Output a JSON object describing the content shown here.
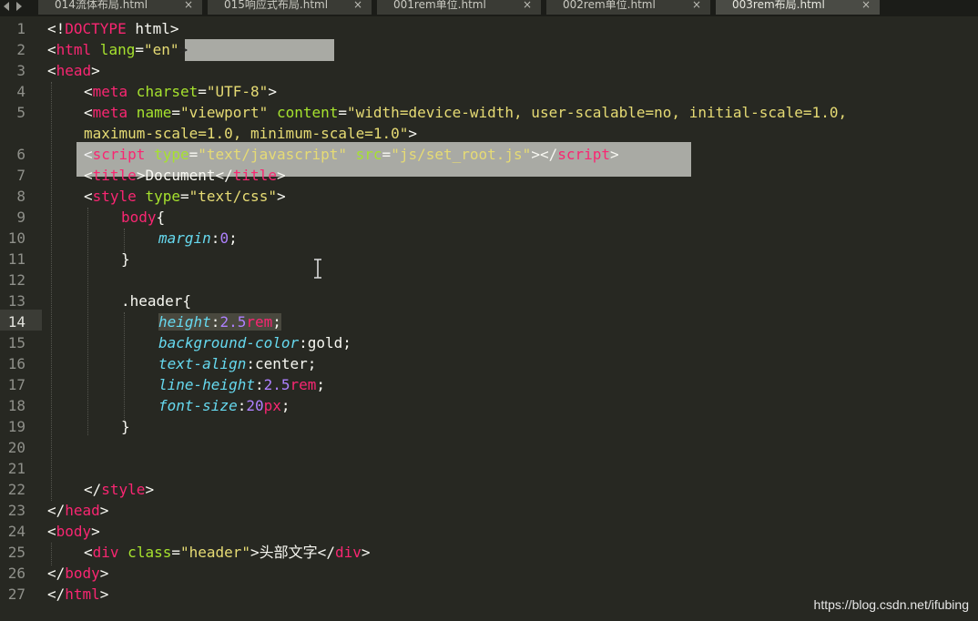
{
  "tabs": [
    {
      "label": "014流体布局.html"
    },
    {
      "label": "015响应式布局.html"
    },
    {
      "label": "001rem单位.html"
    },
    {
      "label": "002rem单位.html"
    },
    {
      "label": "003rem布局.html"
    }
  ],
  "line_numbers": [
    "1",
    "2",
    "3",
    "4",
    "5",
    "6",
    "7",
    "8",
    "9",
    "10",
    "11",
    "12",
    "13",
    "14",
    "15",
    "16",
    "17",
    "18",
    "19",
    "20",
    "21",
    "22",
    "23",
    "24",
    "25",
    "26",
    "27"
  ],
  "code": {
    "l1_a": "<!",
    "l1_b": "DOCTYPE",
    "l1_c": " html>",
    "l2_a": "<",
    "l2_b": "html",
    "l2_c": " lang",
    "l2_d": "=",
    "l2_e": "\"en\"",
    "l2_f": ">",
    "l3_a": "<",
    "l3_b": "head",
    "l3_c": ">",
    "l4_a": "<",
    "l4_b": "meta",
    "l4_c": " charset",
    "l4_d": "=",
    "l4_e": "\"UTF-8\"",
    "l4_f": ">",
    "l5_a": "<",
    "l5_b": "meta",
    "l5_c": " name",
    "l5_d": "=",
    "l5_e": "\"viewport\"",
    "l5_f": " content",
    "l5_g": "=",
    "l5_h": "\"width=device-width, user-scalable=no, initial-scale=1.0,",
    "l5w_a": "maximum-scale=1.0, minimum-scale=1.0\"",
    "l5w_b": ">",
    "l6_a": "<",
    "l6_b": "script",
    "l6_c": " type",
    "l6_d": "=",
    "l6_e": "\"text/javascript\"",
    "l6_f": " src",
    "l6_g": "=",
    "l6_h": "\"js/set_root.js\"",
    "l6_i": "></",
    "l6_j": "script",
    "l6_k": ">",
    "l7_a": "<",
    "l7_b": "title",
    "l7_c": ">Document</",
    "l7_d": "title",
    "l7_e": ">",
    "l8_a": "<",
    "l8_b": "style",
    "l8_c": " type",
    "l8_d": "=",
    "l8_e": "\"text/css\"",
    "l8_f": ">",
    "l9_a": "body",
    "l9_b": "{",
    "l10_a": "margin",
    "l10_b": ":",
    "l10_c": "0",
    "l10_d": ";",
    "l11_a": "}",
    "l13_a": ".header{",
    "l14_a": "height",
    "l14_b": ":",
    "l14_c": "2.5",
    "l14_d": "rem",
    "l14_e": ";",
    "l15_a": "background-color",
    "l15_b": ":gold;",
    "l16_a": "text-align",
    "l16_b": ":center;",
    "l17_a": "line-height",
    "l17_b": ":",
    "l17_c": "2.5",
    "l17_d": "rem",
    "l17_e": ";",
    "l18_a": "font-size",
    "l18_b": ":",
    "l18_c": "20",
    "l18_d": "px",
    "l18_e": ";",
    "l19_a": "}",
    "l22_a": "</",
    "l22_b": "style",
    "l22_c": ">",
    "l23_a": "</",
    "l23_b": "head",
    "l23_c": ">",
    "l24_a": "<",
    "l24_b": "body",
    "l24_c": ">",
    "l25_a": "<",
    "l25_b": "div",
    "l25_c": " class",
    "l25_d": "=",
    "l25_e": "\"header\"",
    "l25_f": ">头部文字</",
    "l25_g": "div",
    "l25_h": ">",
    "l26_a": "</",
    "l26_b": "body",
    "l26_c": ">",
    "l27_a": "</",
    "l27_b": "html",
    "l27_c": ">"
  },
  "watermark": "https://blog.csdn.net/ifubing",
  "colors": {
    "background": "#272822",
    "tag": "#f92672",
    "attribute": "#a6e22e",
    "string": "#e6db74",
    "property": "#66d9ef",
    "number": "#ae81ff"
  },
  "icons": {
    "tab_close": "close-icon",
    "nav": "arrow-icons",
    "text_cursor": "ibeam-cursor-icon"
  }
}
